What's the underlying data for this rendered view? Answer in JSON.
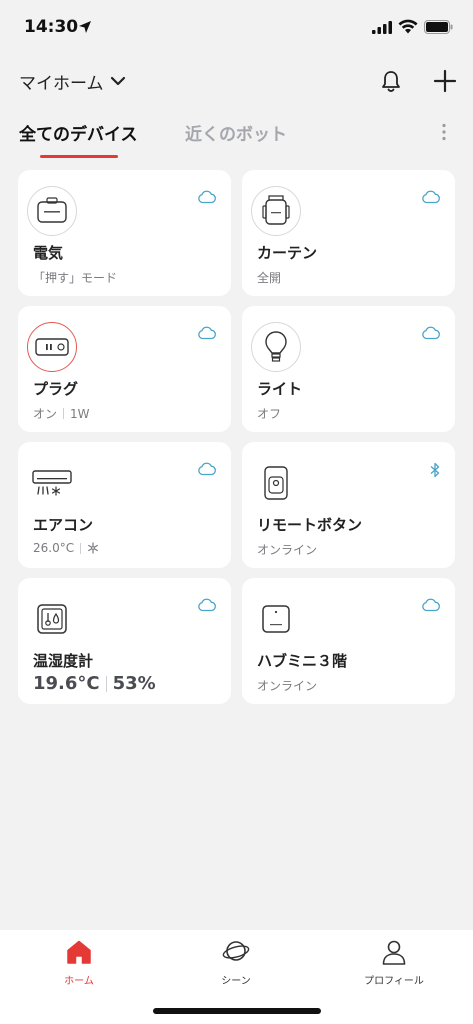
{
  "status_bar": {
    "time": "14:30"
  },
  "header": {
    "home_label": "マイホーム"
  },
  "tabs": {
    "all_devices": "全てのデバイス",
    "nearby_bots": "近くのボット"
  },
  "devices": [
    {
      "name": "電気",
      "sub": [
        "「押す」モード"
      ],
      "icon": "bot-icon",
      "status_icon": "cloud-icon"
    },
    {
      "name": "カーテン",
      "sub": [
        "全開"
      ],
      "icon": "curtain-icon",
      "status_icon": "cloud-icon"
    },
    {
      "name": "プラグ",
      "sub": [
        "オン",
        "1W"
      ],
      "icon": "plug-icon",
      "status_icon": "cloud-icon"
    },
    {
      "name": "ライト",
      "sub": [
        "オフ"
      ],
      "icon": "bulb-icon",
      "status_icon": "cloud-icon"
    },
    {
      "name": "エアコン",
      "sub": [
        "26.0°C"
      ],
      "icon": "air-conditioner-icon",
      "status_icon": "cloud-icon"
    },
    {
      "name": "リモートボタン",
      "sub": [
        "オンライン"
      ],
      "icon": "remote-button-icon",
      "status_icon": "bluetooth-icon"
    },
    {
      "name": "温湿度計",
      "sub": [
        "19.6°C",
        "53%"
      ],
      "icon": "thermo-hygrometer-icon",
      "status_icon": "cloud-icon"
    },
    {
      "name": "ハブミニ３階",
      "sub": [
        "オンライン"
      ],
      "icon": "hub-mini-icon",
      "status_icon": "cloud-icon"
    }
  ],
  "nav": {
    "home": "ホーム",
    "scene": "シーン",
    "profile": "プロフィール"
  },
  "colors": {
    "accent": "#e53935",
    "cloud": "#4aa3c9",
    "background": "#f2f2f3"
  }
}
